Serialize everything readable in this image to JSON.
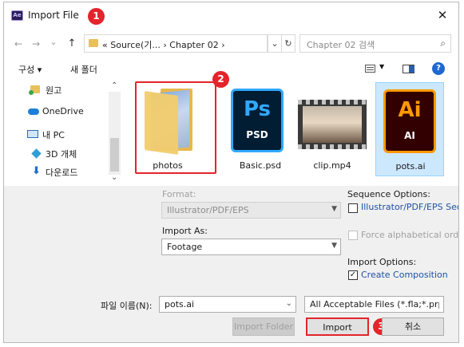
{
  "window": {
    "title": "Import File",
    "app_icon_text": "Ae",
    "close_glyph": "✕"
  },
  "callouts": [
    "1",
    "2",
    "3"
  ],
  "nav": {
    "back_glyph": "←",
    "forward_glyph": "→",
    "dropdown_glyph": "⌄",
    "up_glyph": "↑",
    "breadcrumb": "« Source(기...  ›  Chapter 02  ›",
    "addr_dropdown_glyph": "⌄",
    "refresh_glyph": "↻",
    "search_placeholder": "Chapter 02 검색",
    "search_icon_glyph": "⌕"
  },
  "toolbar": {
    "organize": "구성 ▾",
    "new_folder": "새 폴더",
    "help_glyph": "?"
  },
  "sidebar": {
    "items": [
      {
        "label": "원고"
      },
      {
        "label": "OneDrive"
      },
      {
        "label": "내 PC"
      },
      {
        "label": "3D 개체"
      },
      {
        "label": "다운로드"
      }
    ],
    "scroll_up": "⌃",
    "scroll_down": "⌄"
  },
  "files": [
    {
      "name": "photos",
      "type": "folder"
    },
    {
      "name": "Basic.psd",
      "type": "psd",
      "icon_text": "Ps",
      "sub_text": "PSD"
    },
    {
      "name": "clip.mp4",
      "type": "video"
    },
    {
      "name": "pots.ai",
      "type": "ai",
      "icon_text": "Ai",
      "sub_text": "AI",
      "selected": true
    }
  ],
  "options": {
    "format_label": "Format:",
    "format_value": "Illustrator/PDF/EPS",
    "import_as_label": "Import As:",
    "import_as_value": "Footage",
    "sequence_label": "Sequence Options:",
    "sequence_checkbox": "Illustrator/PDF/EPS Sequence",
    "sequence_checked": false,
    "force_alpha": "Force alphabetical order",
    "import_options_label": "Import Options:",
    "create_composition": "Create Composition",
    "create_composition_checked": true
  },
  "bottom": {
    "filename_label": "파일 이름(N):",
    "filename_value": "pots.ai",
    "filter_value": "All Acceptable Files (*.fla;*.prpr",
    "import_folder": "Import Folder",
    "import": "Import",
    "cancel": "취소"
  },
  "colors": {
    "callout_red": "#e3242b",
    "selection": "#cce8ff",
    "link_blue": "#1f4fa8"
  }
}
